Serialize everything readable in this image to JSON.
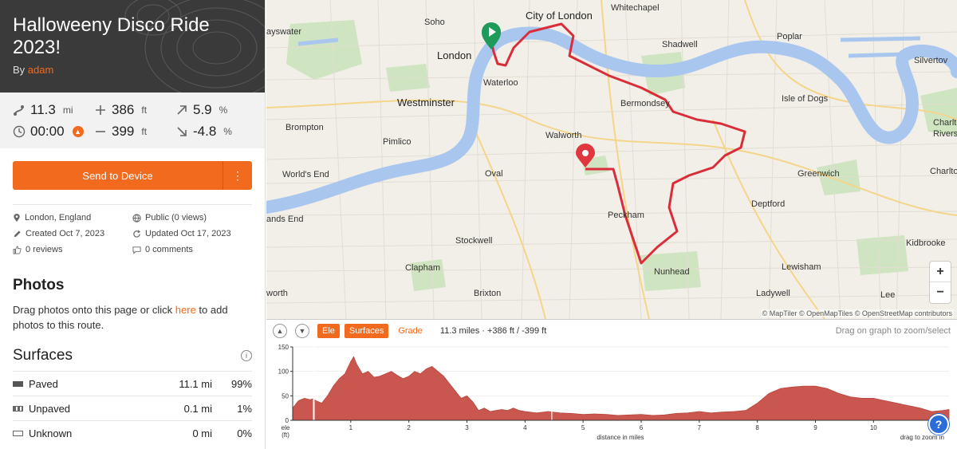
{
  "route": {
    "title": "Halloweeny Disco Ride 2023!",
    "by_prefix": "By",
    "author": "adam"
  },
  "stats": {
    "distance": "11.3",
    "distance_unit": "mi",
    "ascent": "386",
    "ascent_unit": "ft",
    "max_grade": "5.9",
    "max_grade_unit": "%",
    "duration": "00:00",
    "descent": "399",
    "descent_unit": "ft",
    "min_grade": "-4.8",
    "min_grade_unit": "%"
  },
  "actions": {
    "send_label": "Send to Device",
    "more_label": "⋮"
  },
  "meta": {
    "location": "London, England",
    "visibility": "Public (0 views)",
    "created": "Created Oct 7, 2023",
    "updated": "Updated Oct 17, 2023",
    "reviews": "0 reviews",
    "comments": "0 comments"
  },
  "photos": {
    "heading": "Photos",
    "text_before": "Drag photos onto this page or click ",
    "link": "here",
    "text_after": " to add photos to this route."
  },
  "surfaces": {
    "heading": "Surfaces",
    "info": "i",
    "rows": [
      {
        "name": "Paved",
        "dist": "11.1 mi",
        "pct": "99%",
        "color": "#555555"
      },
      {
        "name": "Unpaved",
        "dist": "0.1 mi",
        "pct": "1%",
        "color": "#777777"
      },
      {
        "name": "Unknown",
        "dist": "0 mi",
        "pct": "0%",
        "color": "#ffffff"
      }
    ]
  },
  "map": {
    "places": {
      "whitechapel": "Whitechapel",
      "soho": "Soho",
      "city": "City of London",
      "bayswater": "ayswater",
      "london": "London",
      "shadwell": "Shadwell",
      "poplar": "Poplar",
      "silvertown": "Silvertov",
      "waterloo": "Waterloo",
      "westminster": "Westminster",
      "bermondsey": "Bermondsey",
      "isle": "Isle of Dogs",
      "brompton": "Brompton",
      "charlton_r": "Charltor",
      "riverside": "Riversid",
      "pimlico": "Pimlico",
      "walworth": "Walworth",
      "worlds_end": "World's End",
      "oval": "Oval",
      "greenwich": "Greenwich",
      "charlton": "Charlton",
      "sands_end": "ands End",
      "deptford": "Deptford",
      "peckham": "Peckham",
      "stockwell": "Stockwell",
      "kidbrooke": "Kidbrooke",
      "clapham": "Clapham",
      "nunhead": "Nunhead",
      "lewisham": "Lewisham",
      "brixton": "Brixton",
      "worth": "worth",
      "ladywell": "Ladywell",
      "lee": "Lee"
    },
    "zoom_in": "+",
    "zoom_out": "−",
    "attribution": "© MapTiler © OpenMapTiles © OpenStreetMap contributors"
  },
  "elevation": {
    "up_icon": "chevron-up-icon",
    "down_icon": "chevron-down-icon",
    "tab_ele": "Ele",
    "tab_surfaces": "Surfaces",
    "tab_grade": "Grade",
    "summary": "11.3 miles · +386 ft / -399 ft",
    "hint": "Drag on graph to zoom/select",
    "y_label_1": "ele",
    "y_label_2": "(ft)",
    "x_label": "distance in miles",
    "corner_hint": "drag to zoom in",
    "help": "?"
  },
  "chart_data": {
    "type": "area",
    "xlabel": "distance in miles",
    "ylabel": "ele (ft)",
    "xlim": [
      0,
      11.3
    ],
    "ylim": [
      0,
      150
    ],
    "xticks": [
      1,
      2,
      3,
      4,
      5,
      6,
      7,
      8,
      9,
      10
    ],
    "yticks": [
      0,
      50,
      100,
      150
    ],
    "color": "#c9574f",
    "x": [
      0,
      0.1,
      0.2,
      0.3,
      0.35,
      0.4,
      0.5,
      0.6,
      0.7,
      0.8,
      0.9,
      1.0,
      1.05,
      1.1,
      1.2,
      1.3,
      1.4,
      1.5,
      1.6,
      1.7,
      1.8,
      1.9,
      2.0,
      2.1,
      2.2,
      2.3,
      2.4,
      2.5,
      2.6,
      2.7,
      2.8,
      2.9,
      3.0,
      3.1,
      3.2,
      3.3,
      3.4,
      3.5,
      3.6,
      3.7,
      3.8,
      3.9,
      4.0,
      4.2,
      4.4,
      4.6,
      4.8,
      5.0,
      5.2,
      5.4,
      5.6,
      5.8,
      6.0,
      6.2,
      6.4,
      6.6,
      6.8,
      7.0,
      7.2,
      7.4,
      7.6,
      7.8,
      8.0,
      8.2,
      8.4,
      8.6,
      8.8,
      9.0,
      9.2,
      9.4,
      9.6,
      9.8,
      10.0,
      10.2,
      10.4,
      10.6,
      10.8,
      11.0,
      11.2,
      11.3
    ],
    "y": [
      25,
      40,
      45,
      42,
      44,
      40,
      35,
      50,
      70,
      85,
      95,
      120,
      130,
      115,
      95,
      100,
      88,
      90,
      95,
      100,
      92,
      85,
      90,
      100,
      95,
      105,
      110,
      100,
      90,
      75,
      60,
      45,
      50,
      38,
      20,
      25,
      18,
      20,
      22,
      20,
      25,
      20,
      18,
      15,
      18,
      15,
      14,
      12,
      13,
      12,
      10,
      11,
      12,
      10,
      11,
      14,
      15,
      18,
      15,
      17,
      18,
      20,
      35,
      55,
      65,
      68,
      70,
      70,
      65,
      55,
      48,
      45,
      45,
      40,
      35,
      30,
      25,
      18,
      20,
      22
    ]
  }
}
